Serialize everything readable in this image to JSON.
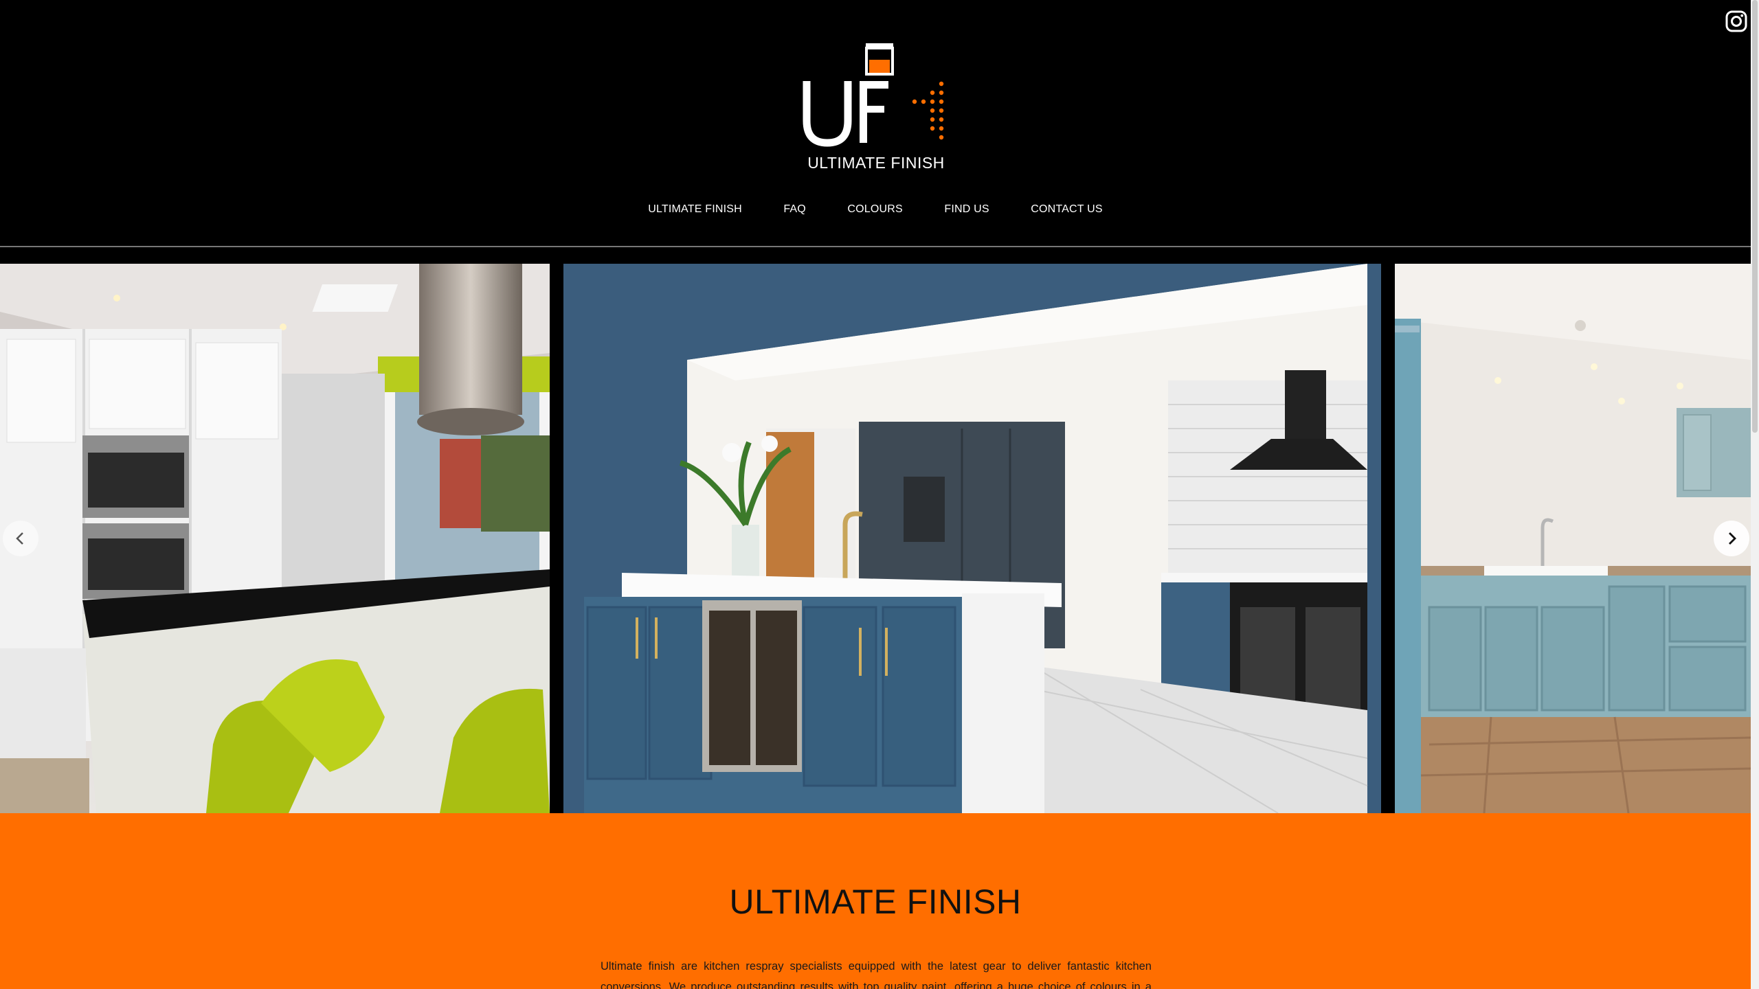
{
  "brand": {
    "name": "ULTIMATE FINISH",
    "accent": "#ff6e00"
  },
  "nav": {
    "items": [
      "ULTIMATE FINISH",
      "FAQ",
      "COLOURS",
      "FIND US",
      "CONTACT US"
    ]
  },
  "social": {
    "icon": "instagram-icon"
  },
  "slider": {
    "prev_icon": "chevron-left-icon",
    "next_icon": "chevron-right-icon",
    "slides": [
      "white-kitchen-lime-stools",
      "blue-kitchen-island",
      "light-blue-kitchen-belfast-sink"
    ]
  },
  "about": {
    "title": "ULTIMATE FINISH",
    "body": "Ultimate finish are kitchen respray specialists equipped with the latest gear to deliver fantastic kitchen conversions. We produce outstanding results with top quality paint, offering a huge choice of colours in a variety"
  }
}
